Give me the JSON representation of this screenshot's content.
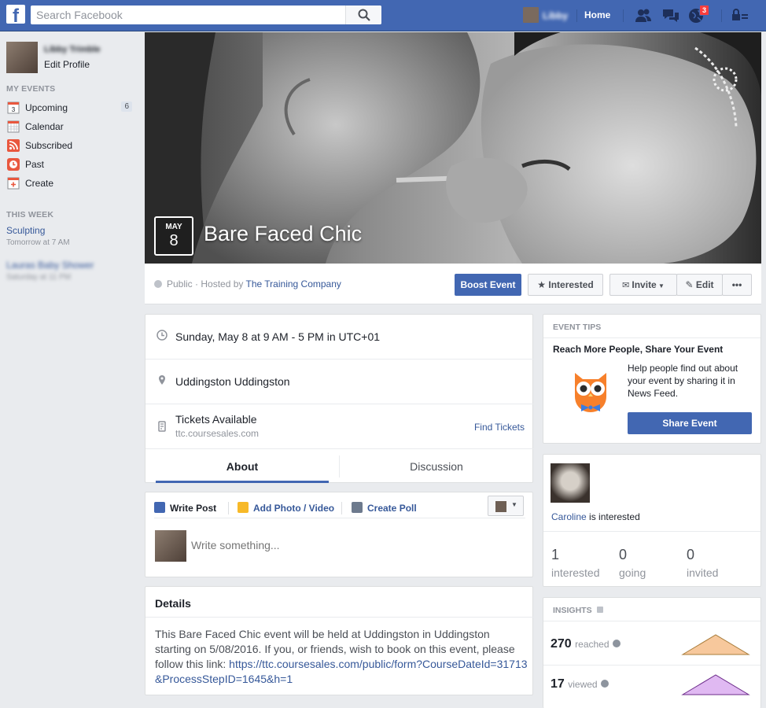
{
  "topbar": {
    "search_placeholder": "Search Facebook",
    "user_name": "Libby",
    "home_label": "Home",
    "notification_count": "3"
  },
  "leftnav": {
    "user_name": "Libby Trimble",
    "edit_profile": "Edit Profile",
    "my_events_header": "MY EVENTS",
    "items": [
      {
        "label": "Upcoming",
        "count": "6",
        "icon": "calendar-3-icon"
      },
      {
        "label": "Calendar",
        "icon": "calendar-grid-icon"
      },
      {
        "label": "Subscribed",
        "icon": "rss-icon"
      },
      {
        "label": "Past",
        "icon": "clock-icon"
      },
      {
        "label": "Create",
        "icon": "plus-calendar-icon"
      }
    ],
    "this_week_header": "THIS WEEK",
    "week_events": [
      {
        "title": "Sculpting",
        "time": "Tomorrow at 7 AM"
      },
      {
        "title": "Lauras Baby Shower",
        "time": "Saturday at 11 PM"
      }
    ]
  },
  "event": {
    "month": "MAY",
    "day": "8",
    "title": "Bare Faced Chic",
    "privacy": "Public · Hosted by ",
    "host": "The Training Company",
    "boost_label": "Boost Event",
    "interested_label": "Interested",
    "invite_label": "Invite",
    "edit_label": "Edit",
    "more_label": "•••"
  },
  "info": {
    "datetime": "Sunday, May 8 at 9 AM - 5 PM in UTC+01",
    "location": "Uddingston Uddingston",
    "tickets_label": "Tickets Available",
    "tickets_url": "ttc.coursesales.com",
    "find_tickets": "Find Tickets"
  },
  "tabs": {
    "about": "About",
    "discussion": "Discussion"
  },
  "composer": {
    "write_post": "Write Post",
    "add_photo": "Add Photo / Video",
    "create_poll": "Create Poll",
    "placeholder": "Write something..."
  },
  "details": {
    "header": "Details",
    "body": "This Bare Faced Chic event will be held at Uddingston in Uddingston starting on 5/08/2016. If you, or friends, wish to book on this event, please follow this link: ",
    "link": "https://ttc.coursesales.com/public/form?CourseDateId=31713&ProcessStepID=1645&h=1"
  },
  "tips": {
    "header": "EVENT TIPS",
    "title": "Reach More People, Share Your Event",
    "text": "Help people find out about your event by sharing it in News Feed.",
    "button": "Share Event"
  },
  "guests": {
    "friend_name": "Caroline",
    "friend_status": " is interested",
    "stats": [
      {
        "value": "1",
        "label": "interested"
      },
      {
        "value": "0",
        "label": "going"
      },
      {
        "value": "0",
        "label": "invited"
      }
    ]
  },
  "insights": {
    "header": "INSIGHTS",
    "rows": [
      {
        "value": "270",
        "label": "reached",
        "color": "#f7c89c"
      },
      {
        "value": "17",
        "label": "viewed",
        "color": "#e0b9f2"
      }
    ]
  },
  "colors": {
    "brand": "#4267b2",
    "link": "#365899",
    "badge": "#fa3e3e"
  }
}
